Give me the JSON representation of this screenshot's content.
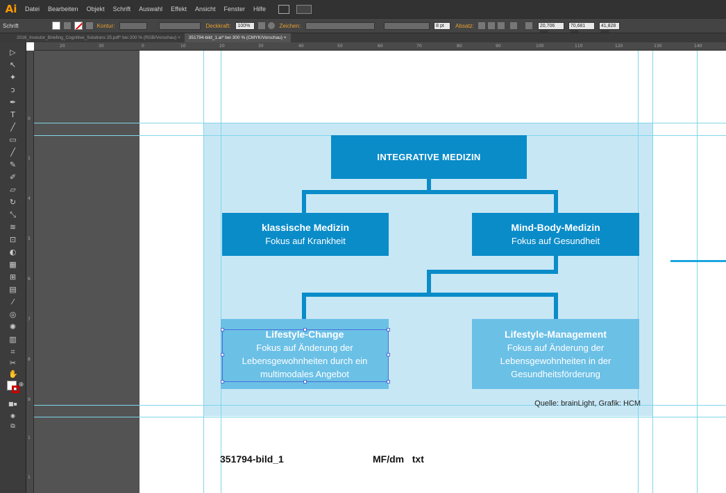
{
  "app": {
    "logo": "Ai"
  },
  "menu": [
    "Datei",
    "Bearbeiten",
    "Objekt",
    "Schrift",
    "Auswahl",
    "Effekt",
    "Ansicht",
    "Fenster",
    "Hilfe"
  ],
  "control_bar": {
    "tool_label": "Schrift",
    "stroke_label": "Kontur:",
    "opacity_label": "Deckkraft:",
    "opacity_value": "100%",
    "char_label": "Zeichen:",
    "size_value": "8 pt",
    "para_label": "Absatz:",
    "x_value": "20,706 mm",
    "y_value": "70,681 mm",
    "w_value": "41,828 mm"
  },
  "tabs": [
    {
      "label": "2016_Investor_Briefing_Cognitive_Solutions 25.pdf* bei 200 % (RGB/Vorschau)",
      "close": "×"
    },
    {
      "label": "351794-bild_1.ai* bei 300 % (CMYK/Vorschau)",
      "close": "×"
    }
  ],
  "ruler": {
    "top_labels": [
      "20",
      "30",
      "0",
      "10",
      "20",
      "30",
      "40",
      "50",
      "60",
      "70",
      "80",
      "90",
      "100",
      "110",
      "120",
      "130",
      "140"
    ],
    "left_labels": [
      "0",
      "1",
      "4",
      "5",
      "6",
      "7",
      "8",
      "9",
      "1",
      "1"
    ]
  },
  "diagram": {
    "root": "INTEGRATIVE MEDIZIN",
    "left": {
      "title": "klassische Medizin",
      "subtitle": "Fokus auf Krankheit"
    },
    "right": {
      "title": "Mind-Body-Medizin",
      "subtitle": "Fokus auf Gesundheit"
    },
    "bottom_left": {
      "title": "Lifestyle-Change",
      "lines": [
        "Fokus auf Änderung der",
        "Lebensgewohnheiten durch ein",
        "multimodales Angebot"
      ]
    },
    "bottom_right": {
      "title": "Lifestyle-Management",
      "lines": [
        "Fokus auf Änderung der",
        "Lebensgewohnheiten in der",
        "Gesundheitsförderung"
      ]
    },
    "source": "Quelle: brainLight, Grafik: HCM"
  },
  "footer": {
    "file_id": "351794-bild_1",
    "codes": "MF/dm   txt"
  },
  "colors": {
    "box_dark": "#0a8cc9",
    "box_light": "#6bc0e6",
    "panel_bg": "#c8e7f5",
    "guide": "#7fd6ea",
    "selection": "#4a6dd8"
  }
}
